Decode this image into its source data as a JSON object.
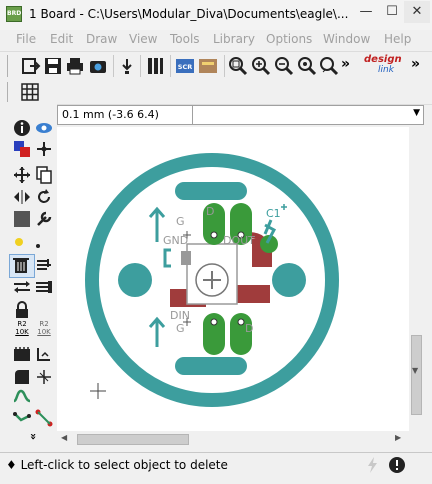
{
  "window": {
    "title": "1 Board - C:\\Users\\Modular_Diva\\Documents\\eagle\\...",
    "app_icon_text": "BRD",
    "controls": {
      "minimize": "—",
      "maximize": "☐",
      "close": "✕"
    }
  },
  "menu": {
    "items": [
      "File",
      "Edit",
      "Draw",
      "View",
      "Tools",
      "Library",
      "Options",
      "Window",
      "Help"
    ]
  },
  "toolbar": {
    "icons": [
      "open-icon",
      "save-icon",
      "print-icon",
      "cam-icon",
      "import-icon",
      "grid-level-icon",
      "script-icon",
      "run-icon",
      "zoom-fit-icon",
      "zoom-in-icon",
      "zoom-out-icon",
      "zoom-redraw-icon",
      "zoom-select-icon"
    ],
    "script_label": "SCR",
    "overflow": "»",
    "designlink": {
      "top": "design",
      "bottom": "link"
    }
  },
  "coordinates": {
    "readout": "0.1 mm (-3.6 6.4)",
    "dropdown": "▼"
  },
  "leftbar": {
    "icons": [
      "info-icon",
      "eye-icon",
      "layer-icon",
      "mark-icon",
      "move-icon",
      "copy-icon",
      "mirror-icon",
      "rotate-icon",
      "group-icon",
      "change-icon",
      "paste-icon",
      "delete-icon",
      "add-icon",
      "pinswap-icon",
      "replace-icon",
      "lock-icon",
      "smash-icon",
      "split-icon",
      "optimize-icon",
      "route-icon",
      "miter-icon",
      "wire-icon",
      "text-icon",
      "circle-icon",
      "arc-icon",
      "rect-icon",
      "polygon-icon",
      "via-icon",
      "hole-icon",
      "attribute-icon",
      "dimension-icon",
      "ratsnest-icon",
      "autorouter-icon",
      "erc-icon",
      "more-icon"
    ],
    "name_labels": {
      "name1": "R2",
      "name1b": "10K",
      "name2": "R2",
      "name2b": "10K"
    },
    "more": "»"
  },
  "board": {
    "labels": {
      "g_top": "G",
      "d_top": "D",
      "c1": "C1",
      "gnd": "GND",
      "dout": "DOUT",
      "g_bot": "G",
      "din": "DIN",
      "d_bot": "D"
    },
    "colors": {
      "outline": "#3d9e9e",
      "pad_green": "#3a9a3a",
      "trace_red": "#a03c3c",
      "silk_grey": "#9a9a9a",
      "bg": "#ffffff"
    }
  },
  "status": {
    "text": "♦ Left-click to select object to delete"
  }
}
